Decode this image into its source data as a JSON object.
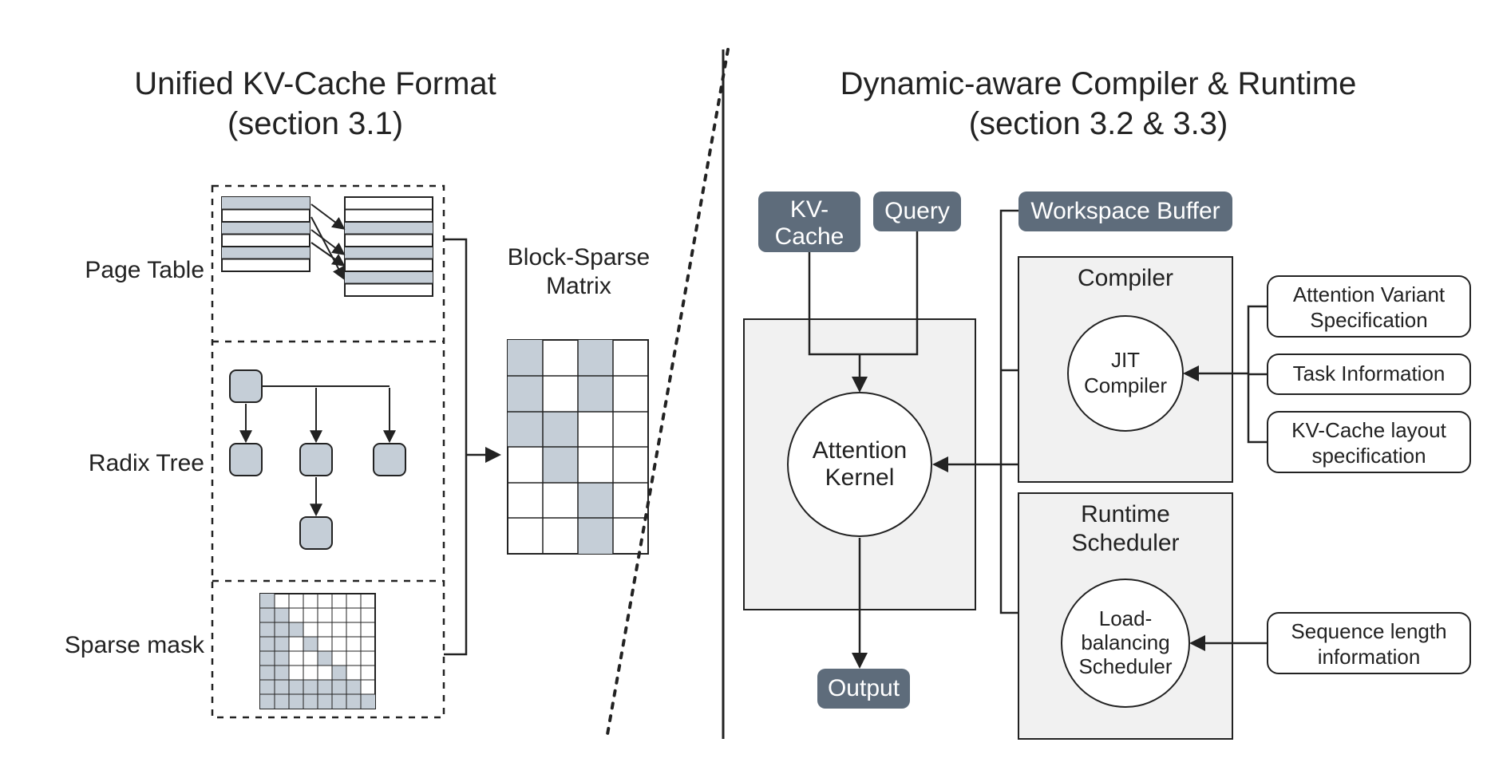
{
  "left": {
    "title1": "Unified KV-Cache Format",
    "title2": "(section 3.1)",
    "page_table": "Page Table",
    "radix_tree": "Radix Tree",
    "sparse_mask": "Sparse mask",
    "block_sparse1": "Block-Sparse",
    "block_sparse2": "Matrix"
  },
  "right": {
    "title1": "Dynamic-aware Compiler & Runtime",
    "title2": "(section 3.2 & 3.3)",
    "kv_cache1": "KV-",
    "kv_cache2": "Cache",
    "query": "Query",
    "workspace_buffer": "Workspace Buffer",
    "attention1": "Attention",
    "attention2": "Kernel",
    "output": "Output",
    "compiler": "Compiler",
    "jit1": "JIT",
    "jit2": "Compiler",
    "runtime1": "Runtime",
    "runtime2": "Scheduler",
    "lb1": "Load-",
    "lb2": "balancing",
    "lb3": "Scheduler",
    "attn_variant1": "Attention Variant",
    "attn_variant2": "Specification",
    "task_info": "Task Information",
    "kvlayout1": "KV-Cache layout",
    "kvlayout2": "specification",
    "seqlen1": "Sequence length",
    "seqlen2": "information"
  },
  "colors": {
    "box_fill": "#c5ced7",
    "dark_fill": "#5e6c7b",
    "panel_fill": "#f1f1f1",
    "stroke": "#222"
  }
}
